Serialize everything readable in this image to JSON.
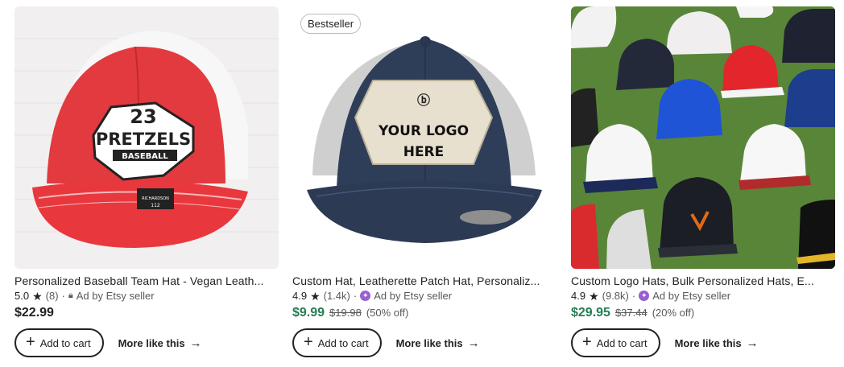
{
  "listings": [
    {
      "title": "Personalized Baseball Team Hat - Vegan Leath...",
      "rating": "5.0",
      "reviews": "(8)",
      "sep": "·",
      "ad_text": "Ad by Etsy seller",
      "price": "$22.99",
      "patch_number": "23",
      "patch_team": "PRETZELS",
      "patch_sub": "BASEBALL",
      "tag_text": "RICHARDSON",
      "tag_num": "112"
    },
    {
      "badge": "Bestseller",
      "title": "Custom Hat, Leatherette Patch Hat, Personaliz...",
      "rating": "4.9",
      "reviews": "(1.4k)",
      "sep": "·",
      "ad_text": "Ad by Etsy seller",
      "price": "$9.99",
      "original_price": "$19.98",
      "discount": "(50% off)",
      "patch_line1": "YOUR LOGO",
      "patch_line2": "HERE"
    },
    {
      "title": "Custom Logo Hats, Bulk Personalized Hats, E...",
      "rating": "4.9",
      "reviews": "(9.8k)",
      "sep": "·",
      "ad_text": "Ad by Etsy seller",
      "price": "$29.95",
      "original_price": "$37.44",
      "discount": "(20% off)"
    }
  ],
  "buttons": {
    "add_to_cart": "Add to cart",
    "more_like_this": "More like this"
  },
  "icons": {
    "star": "★",
    "plus": "+",
    "arrow": "→",
    "lock": "🔒︎",
    "seller": "✦"
  },
  "colors": {
    "sale_price": "#257d53",
    "seller_badge": "#9560cf",
    "text": "#222222"
  }
}
